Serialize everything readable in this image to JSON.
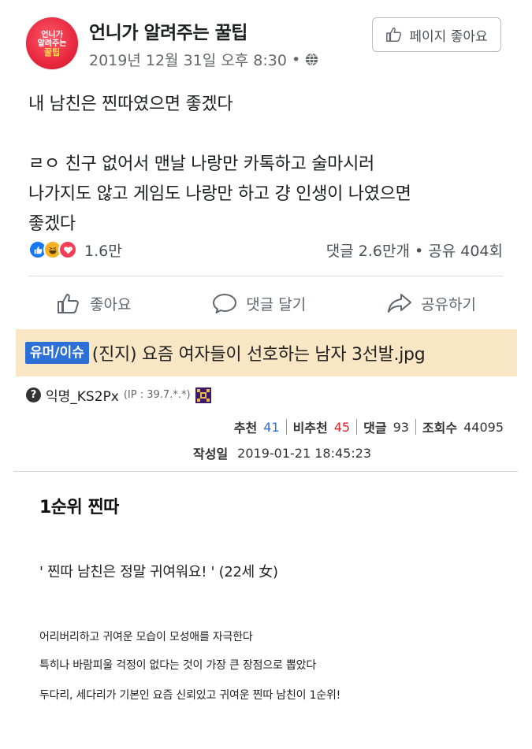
{
  "facebook_post": {
    "page": {
      "logo_lines": [
        "언니가",
        "알려주는",
        "꿀팁"
      ],
      "name": "언니가 알려주는 꿀팁",
      "timestamp": "2019년 12월 31일 오후 8:30",
      "meta_separator": "•",
      "audience_icon": "globe-icon"
    },
    "like_page_button": {
      "icon": "thumbs-up-icon",
      "label": "페이지 좋아요"
    },
    "body": {
      "line1": "내 남친은 찐따였으면 좋겠다",
      "line2": "ㄹㅇ 친구 없어서 맨날 나랑만 카톡하고 술마시러",
      "line3": "나가지도 않고 게임도 나랑만 하고 걍 인생이 나였으면",
      "line4": "좋겠다"
    },
    "reactions": {
      "icons": [
        "like-reaction-icon",
        "haha-reaction-icon",
        "love-reaction-icon"
      ],
      "count": "1.6만",
      "engagement": "댓글 2.6만개 • 공유 404회"
    },
    "actions": {
      "like": "좋아요",
      "comment": "댓글 달기",
      "share": "공유하기"
    },
    "colors": {
      "like_blue": "#1877f2",
      "haha_yellow": "#f7b125",
      "love_red": "#f33e58"
    }
  },
  "community_post": {
    "category": "유머/이슈",
    "title": "(진지) 요즘 여자들이 선호하는 남자 3선발.jpg",
    "author": {
      "name": "익명_KS2Px",
      "ip": "(IP : 39.7.*.*)",
      "level_icon": "level-badge-icon"
    },
    "stats": {
      "recommend_label": "추천",
      "recommend_value": "41",
      "not_recommend_label": "비추천",
      "not_recommend_value": "45",
      "comments_label": "댓글",
      "comments_value": "93",
      "views_label": "조회수",
      "views_value": "44095"
    },
    "date_label": "작성일",
    "date_value": "2019-01-21 18:45:23",
    "colors": {
      "title_bg": "#f9e6c4",
      "tag_bg": "#2c6fd6",
      "recommend": "#2c6fd6",
      "not_recommend": "#d8262a"
    }
  },
  "article": {
    "heading": "1순위 찐따",
    "quote": "' 찐따 남친은 정말 귀여워요! ' (22세 女)",
    "line1": "어리버리하고 귀여운 모습이 모성애를 자극한다",
    "line2": "특히나 바람피울 걱정이 없다는 것이 가장 큰 장점으로 뽑았다",
    "line3": "두다리, 세다리가 기본인 요즘 신뢰있고 귀여운 찐따 남친이 1순위!"
  }
}
